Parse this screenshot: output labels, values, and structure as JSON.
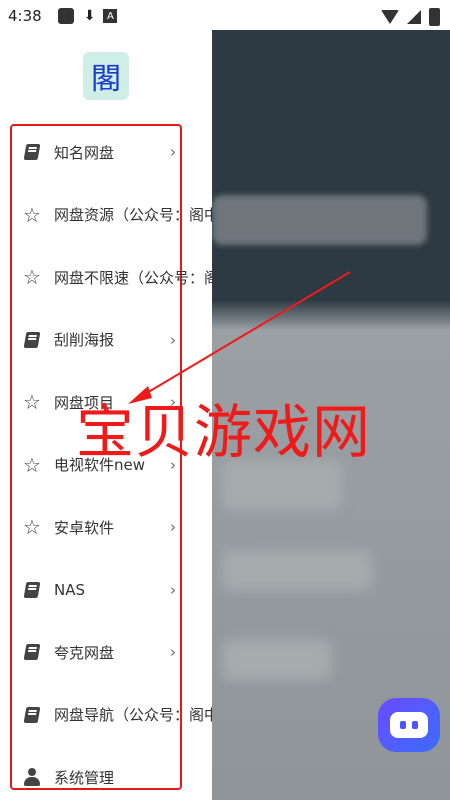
{
  "status_bar": {
    "time": "4:38"
  },
  "logo": {
    "char": "閣"
  },
  "menu": {
    "items": [
      {
        "label": "知名网盘",
        "icon": "book-icon",
        "chevron": "›"
      },
      {
        "label": "网盘资源（公众号：阁中",
        "icon": "star-icon"
      },
      {
        "label": "网盘不限速（公众号：阁",
        "icon": "star-icon"
      },
      {
        "label": "刮削海报",
        "icon": "book-icon",
        "chevron": "›"
      },
      {
        "label": "网盘项目",
        "icon": "star-icon",
        "chevron": "›"
      },
      {
        "label": "电视软件new",
        "icon": "star-icon",
        "chevron": "›"
      },
      {
        "label": "安卓软件",
        "icon": "star-icon",
        "chevron": "›"
      },
      {
        "label": "NAS",
        "icon": "book-icon",
        "chevron": "›"
      },
      {
        "label": "夸克网盘",
        "icon": "book-icon",
        "chevron": "›"
      },
      {
        "label": "网盘导航（公众号：阁中",
        "icon": "book-icon"
      },
      {
        "label": "系统管理",
        "icon": "person-icon"
      }
    ]
  },
  "watermark": {
    "text": "宝贝游戏网",
    "color": "#ef1b1b"
  },
  "colors": {
    "highlight_border": "#e51919",
    "logo_bg": "#cfeee6",
    "logo_fg": "#1a3bd1"
  }
}
